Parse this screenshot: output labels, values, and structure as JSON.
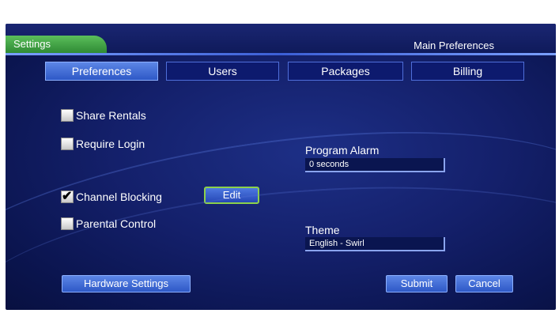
{
  "header": {
    "section_tab": "Settings",
    "breadcrumb": "Main Preferences"
  },
  "tabs": [
    {
      "label": "Preferences",
      "active": true
    },
    {
      "label": "Users",
      "active": false
    },
    {
      "label": "Packages",
      "active": false
    },
    {
      "label": "Billing",
      "active": false
    }
  ],
  "options": [
    {
      "label": "Share Rentals",
      "checked": false
    },
    {
      "label": "Require Login",
      "checked": false
    },
    {
      "label": "Channel Blocking",
      "checked": true
    },
    {
      "label": "Parental Control",
      "checked": false
    }
  ],
  "edit_label": "Edit",
  "program_alarm": {
    "label": "Program Alarm",
    "value": "0 seconds"
  },
  "theme": {
    "label": "Theme",
    "value": "English - Swirl"
  },
  "buttons": {
    "hardware": "Hardware Settings",
    "submit": "Submit",
    "cancel": "Cancel"
  },
  "colors": {
    "background": "#14206b",
    "tab_accent": "#3a9a3f",
    "button": "#3f67d6",
    "focus_outline": "#8cd14b"
  }
}
